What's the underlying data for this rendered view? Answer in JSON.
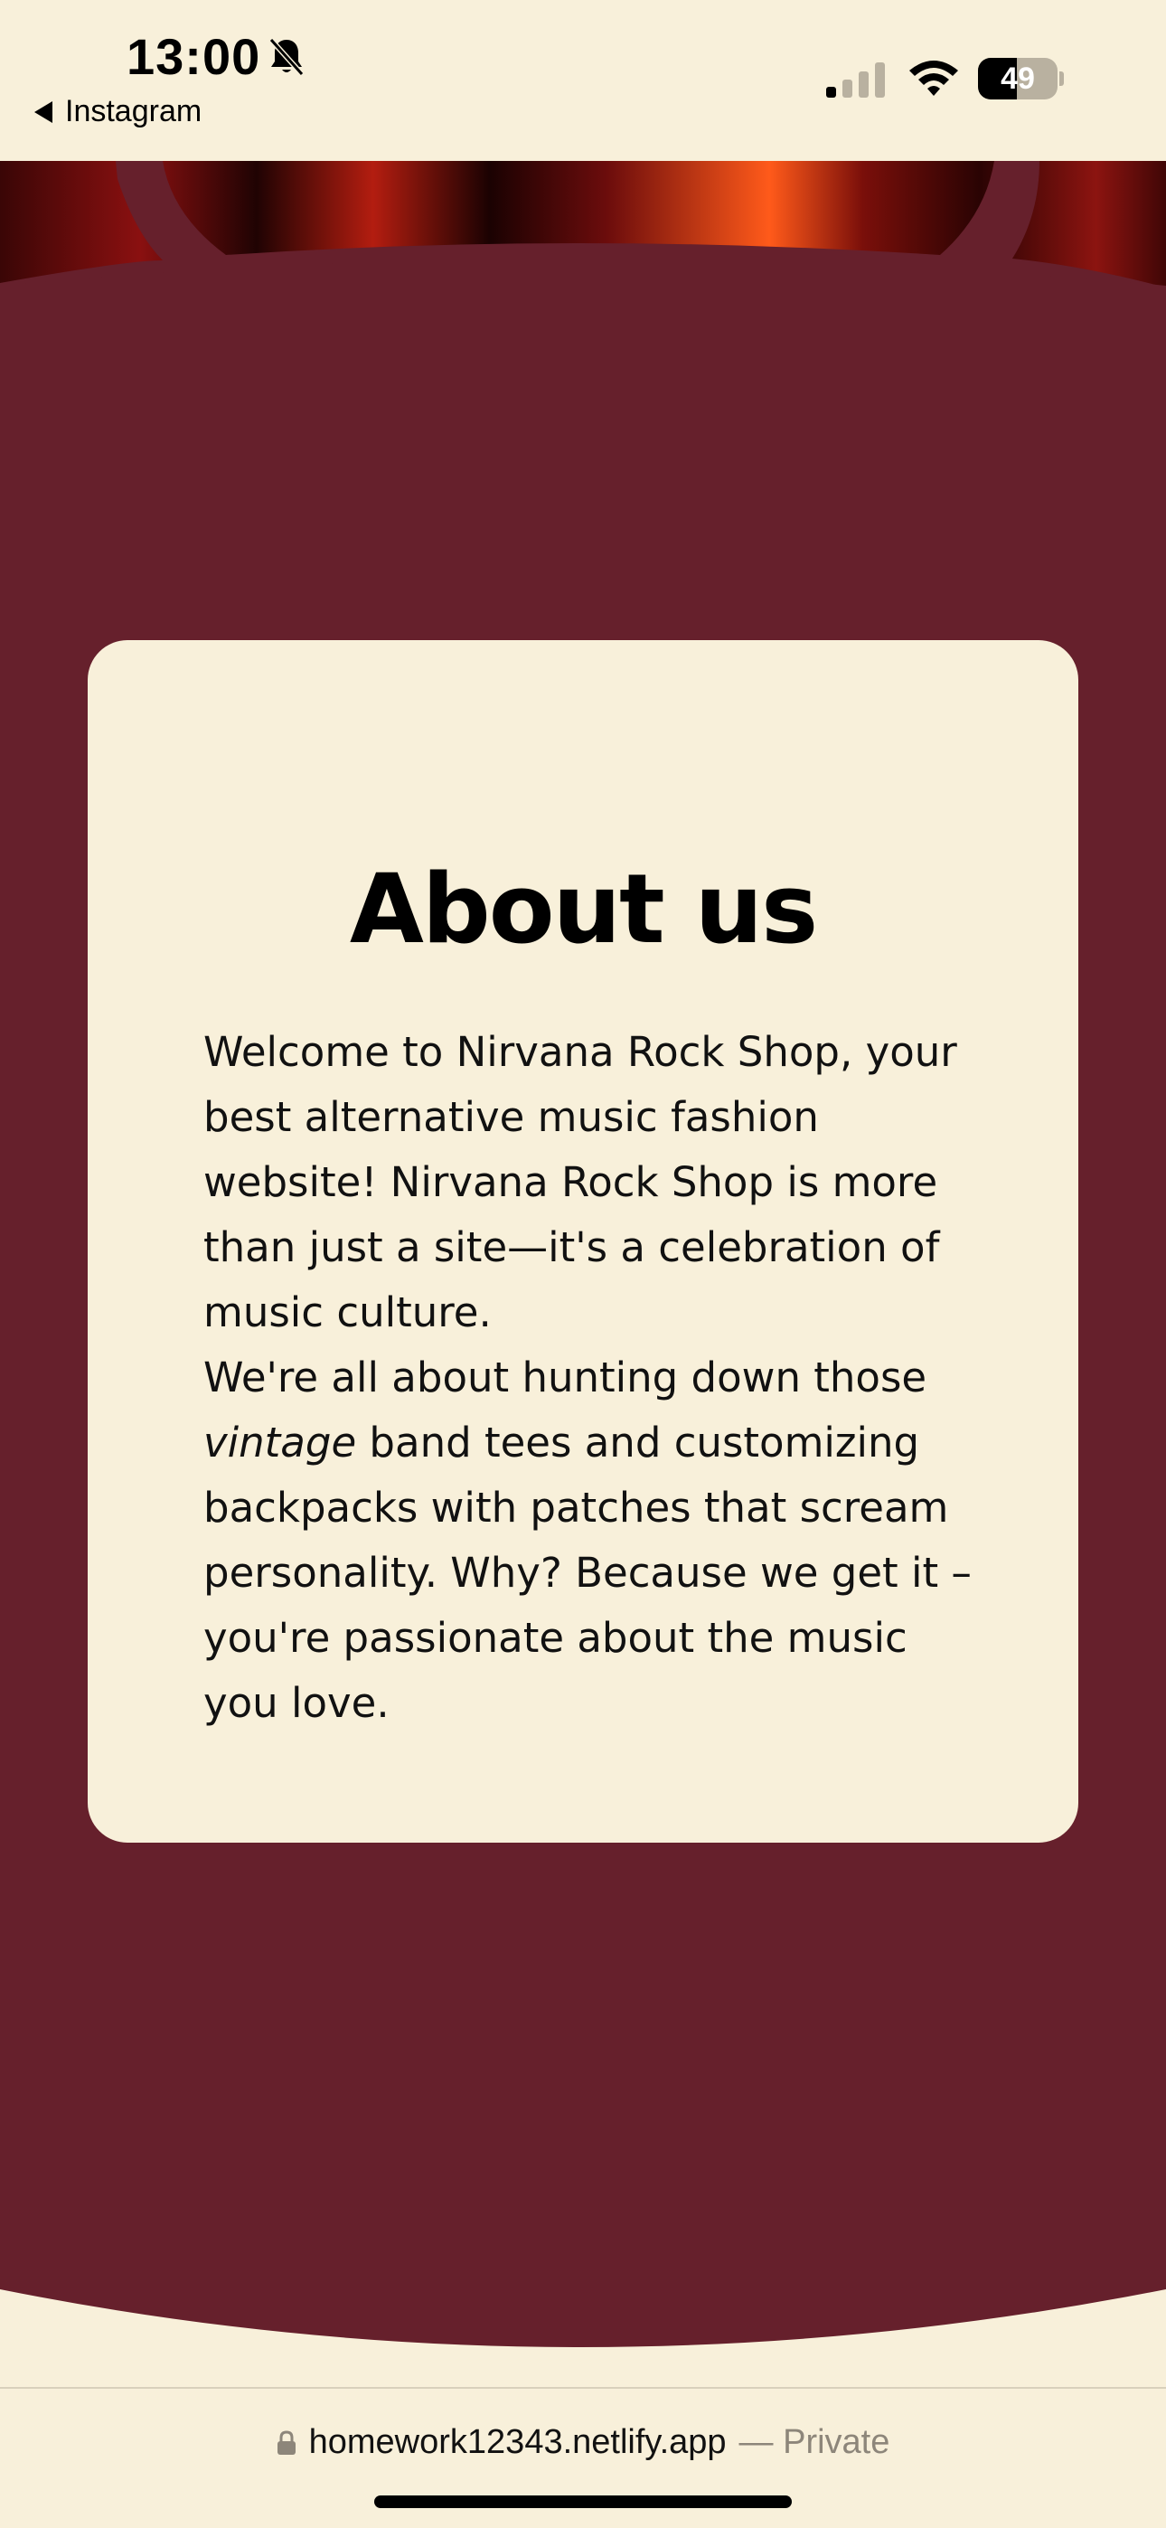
{
  "status_bar": {
    "time": "13:00",
    "back_label": "Instagram",
    "battery_level": "49",
    "battery_fraction": 0.49,
    "icons": [
      "bell-slash-icon",
      "signal-icon",
      "wifi-icon",
      "battery-icon"
    ]
  },
  "about": {
    "title": "About us",
    "paragraph_1": "Welcome to Nirvana Rock Shop, your best alternative music fashion website! Nirvana Rock Shop is more than just a site—it's a celebration of music culture.",
    "paragraph_2_before": "We're all about hunting down those ",
    "paragraph_2_em": "vintage",
    "paragraph_2_after": " band tees and customizing backpacks with patches that scream personality. Why? Because we get it – you're passionate about the music you love."
  },
  "url_bar": {
    "domain": "homework12343.netlify.app",
    "suffix": "— Private"
  },
  "colors": {
    "background": "#f8f0da",
    "maroon": "#66202c",
    "text": "#111111"
  }
}
